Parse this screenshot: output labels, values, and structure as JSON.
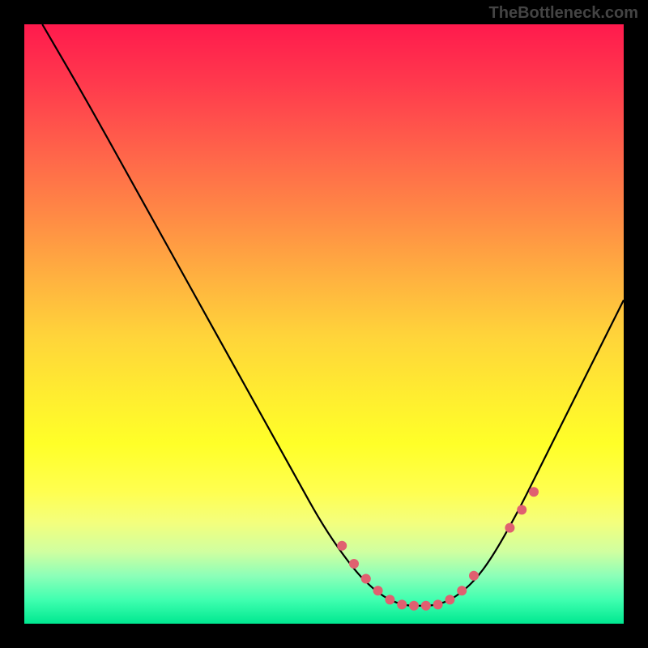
{
  "watermark": "TheBottleneck.com",
  "chart_data": {
    "type": "line",
    "title": "",
    "xlabel": "",
    "ylabel": "",
    "xlim": [
      0,
      100
    ],
    "ylim": [
      0,
      100
    ],
    "series": [
      {
        "name": "curve",
        "x": [
          3,
          10,
          20,
          30,
          40,
          45,
          50,
          55,
          58,
          60,
          62,
          64,
          66,
          68,
          70,
          72,
          75,
          78,
          82,
          86,
          90,
          95,
          100
        ],
        "y": [
          100,
          88,
          70,
          52,
          34,
          25,
          16,
          9,
          6,
          4.5,
          3.5,
          3,
          3,
          3,
          3.5,
          4.5,
          7,
          11,
          18,
          26,
          34,
          44,
          54
        ]
      }
    ],
    "markers": [
      {
        "x": 53,
        "y": 13
      },
      {
        "x": 55,
        "y": 10
      },
      {
        "x": 57,
        "y": 7.5
      },
      {
        "x": 59,
        "y": 5.5
      },
      {
        "x": 61,
        "y": 4
      },
      {
        "x": 63,
        "y": 3.2
      },
      {
        "x": 65,
        "y": 3
      },
      {
        "x": 67,
        "y": 3
      },
      {
        "x": 69,
        "y": 3.2
      },
      {
        "x": 71,
        "y": 4
      },
      {
        "x": 73,
        "y": 5.5
      },
      {
        "x": 75,
        "y": 8
      },
      {
        "x": 81,
        "y": 16
      },
      {
        "x": 83,
        "y": 19
      },
      {
        "x": 85,
        "y": 22
      }
    ],
    "marker_color": "#e06070",
    "curve_color": "#000000"
  }
}
